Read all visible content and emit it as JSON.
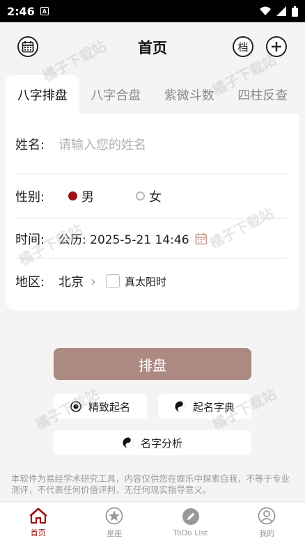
{
  "status": {
    "time": "2:46",
    "sim_letter": "A"
  },
  "header": {
    "title": "首页",
    "archive_label": "档"
  },
  "tabs": [
    {
      "label": "八字排盘",
      "active": true
    },
    {
      "label": "八字合盘",
      "active": false
    },
    {
      "label": "紫微斗数",
      "active": false
    },
    {
      "label": "四柱反查",
      "active": false
    }
  ],
  "form": {
    "name_label": "姓名:",
    "name_placeholder": "请输入您的姓名",
    "gender_label": "性别:",
    "gender_male": "男",
    "gender_female": "女",
    "time_label": "时间:",
    "time_value": "公历: 2025-5-21 14:46",
    "region_label": "地区:",
    "region_value": "北京",
    "solar_time_label": "真太阳时"
  },
  "actions": {
    "primary": "排盘",
    "fine_naming": "精致起名",
    "naming_dict": "起名字典",
    "name_analysis": "名字分析"
  },
  "disclaimer": "本软件为易经学术研究工具，内容仅供您在娱乐中探索自我，不等于专业测评，不代表任何价值评判，无任何现实指导意义。",
  "nav": [
    {
      "label": "首页",
      "icon": "home-icon",
      "active": true
    },
    {
      "label": "星座",
      "icon": "star-icon",
      "active": false
    },
    {
      "label": "ToDo List",
      "icon": "pencil-icon",
      "active": false
    },
    {
      "label": "我的",
      "icon": "profile-icon",
      "active": false
    }
  ],
  "watermark": "橘子下载站",
  "colors": {
    "accent": "#9a1313",
    "primary_button": "#ac8a82",
    "background": "#f5f4f2"
  }
}
